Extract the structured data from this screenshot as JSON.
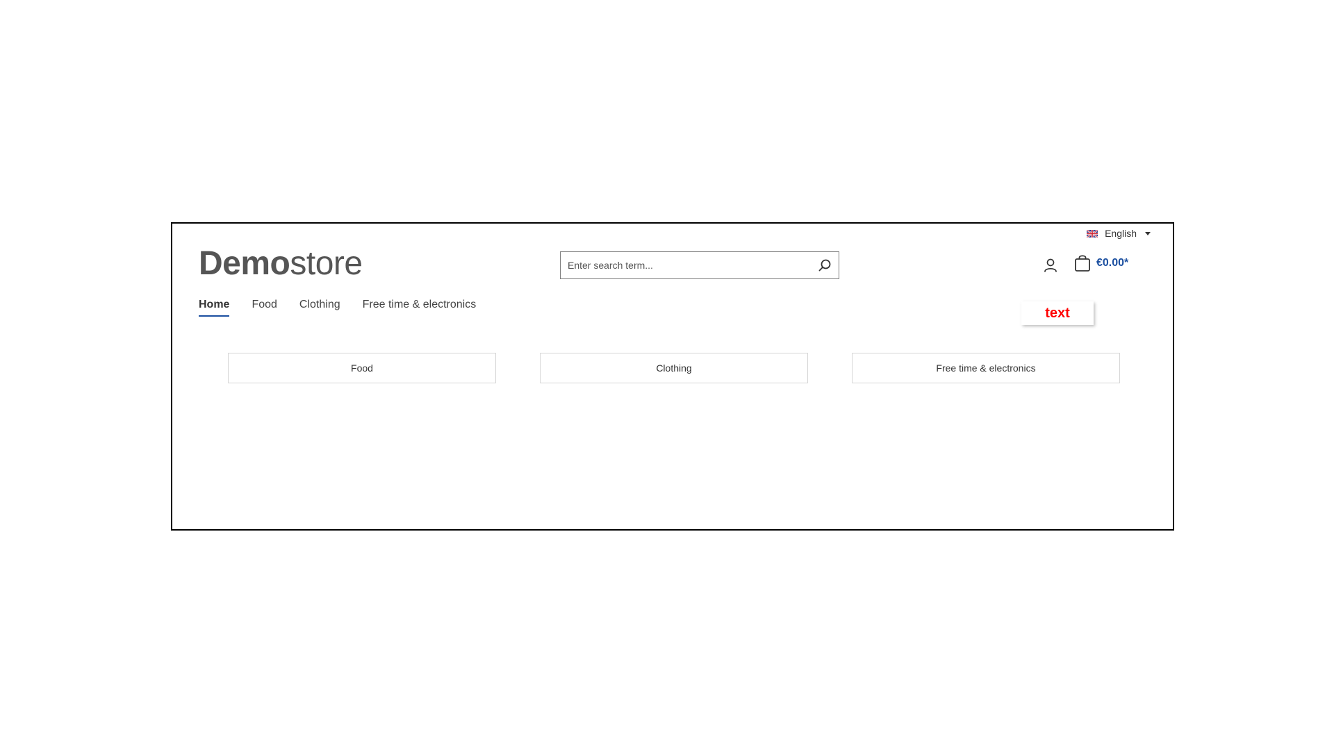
{
  "header": {
    "language": {
      "label": "English",
      "flag": "uk-flag-icon"
    },
    "logo": {
      "bold": "Demo",
      "light": "store"
    },
    "search": {
      "placeholder": "Enter search term..."
    },
    "account_icon": "user-icon",
    "cart": {
      "icon": "shopping-bag-icon",
      "price": "€0.00*"
    }
  },
  "nav": {
    "items": [
      {
        "label": "Home",
        "active": true
      },
      {
        "label": "Food",
        "active": false
      },
      {
        "label": "Clothing",
        "active": false
      },
      {
        "label": "Free time & electronics",
        "active": false
      }
    ]
  },
  "sticker": {
    "label": "text",
    "color": "#ff0000"
  },
  "categories": [
    {
      "label": "Food"
    },
    {
      "label": "Clothing"
    },
    {
      "label": "Free time & electronics"
    }
  ],
  "colors": {
    "accent": "#1b4fa0",
    "logo": "#555555"
  }
}
